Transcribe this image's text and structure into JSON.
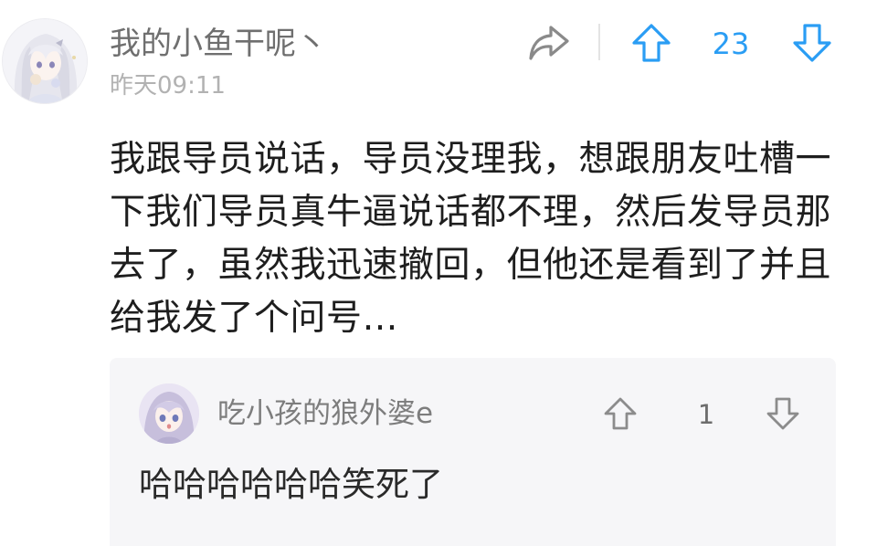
{
  "comment": {
    "author": "我的小鱼干呢丶",
    "time": "昨天09:11",
    "vote_count": "23",
    "text": "我跟导员说话，导员没理我，想跟朋友吐槽一下我们导员真牛逼说话都不理，然后发导员那去了，虽然我迅速撤回，但他还是看到了并且给我发了个问号…"
  },
  "reply": {
    "author": "吃小孩的狼外婆e",
    "vote_count": "1",
    "text": "哈哈哈哈哈哈笑死了"
  },
  "icons": {
    "share": "share-icon",
    "upvote": "arrow-up-icon",
    "downvote": "arrow-down-icon"
  },
  "colors": {
    "accent": "#2a9df4",
    "reply_card_bg": "#f6f6f8"
  }
}
